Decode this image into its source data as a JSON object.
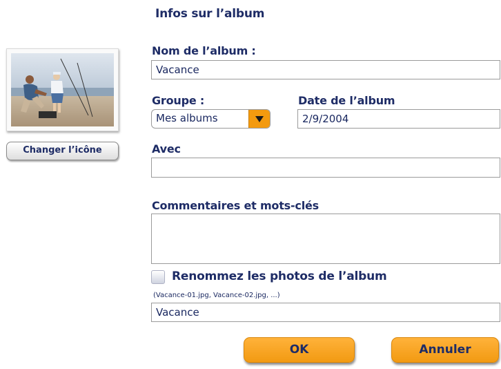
{
  "header": {
    "title": "Infos sur l’album"
  },
  "thumbnail": {
    "change_icon_label": "Changer l’icône"
  },
  "form": {
    "album_name": {
      "label": "Nom de l’album :",
      "value": "Vacance"
    },
    "group": {
      "label": "Groupe :",
      "selected": "Mes albums"
    },
    "album_date": {
      "label": "Date de l’album",
      "value": "2/9/2004"
    },
    "with": {
      "label": "Avec",
      "value": ""
    },
    "comments": {
      "label": "Commentaires et mots-clés",
      "value": ""
    },
    "rename": {
      "label": "Renommez les photos de l’album",
      "checked": false,
      "hint": "(Vacance-01.jpg, Vacance-02.jpg, ...)",
      "value": "Vacance"
    }
  },
  "actions": {
    "ok_label": "OK",
    "cancel_label": "Annuler"
  },
  "colors": {
    "accent_orange": "#f39a0f",
    "label_navy": "#1e2c66"
  }
}
